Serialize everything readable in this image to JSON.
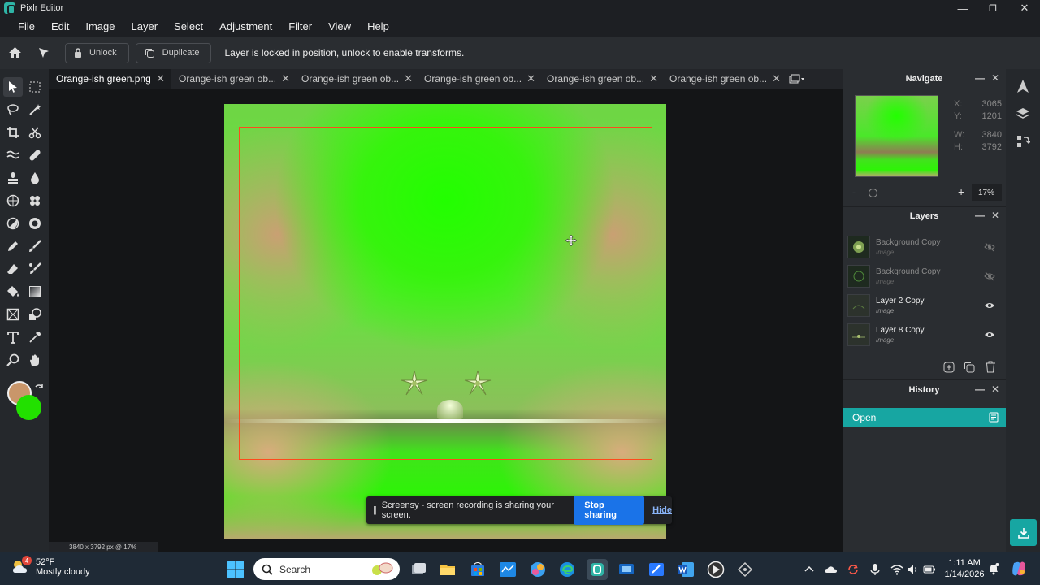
{
  "window": {
    "title": "Pixlr Editor",
    "minimize": "—",
    "maximize": "❐",
    "close": "✕"
  },
  "menu": [
    "File",
    "Edit",
    "Image",
    "Layer",
    "Select",
    "Adjustment",
    "Filter",
    "View",
    "Help"
  ],
  "toolbar": {
    "unlock_label": "Unlock",
    "duplicate_label": "Duplicate",
    "message": "Layer is locked in position, unlock to enable transforms."
  },
  "tabs": [
    {
      "label": "Orange-ish green.png",
      "active": true
    },
    {
      "label": "Orange-ish green ob...",
      "active": false
    },
    {
      "label": "Orange-ish green ob...",
      "active": false
    },
    {
      "label": "Orange-ish green ob...",
      "active": false
    },
    {
      "label": "Orange-ish green ob...",
      "active": false
    },
    {
      "label": "Orange-ish green ob...",
      "active": false
    }
  ],
  "share_bar": {
    "pause": "||",
    "message": "Screensy - screen recording is sharing your screen.",
    "stop_label": "Stop sharing",
    "hide_label": "Hide"
  },
  "status": {
    "size_text": "3840 x 3792 px @ 17%"
  },
  "navigate": {
    "title": "Navigate",
    "x_label": "X:",
    "x_value": "3065",
    "y_label": "Y:",
    "y_value": "1201",
    "w_label": "W:",
    "w_value": "3840",
    "h_label": "H:",
    "h_value": "3792",
    "zoom_minus": "-",
    "zoom_plus": "+",
    "zoom_value": "17%",
    "zoom_level_pct": 17
  },
  "layers": {
    "title": "Layers",
    "items": [
      {
        "name": "Background Copy",
        "type": "Image",
        "visible": false
      },
      {
        "name": "Background Copy",
        "type": "Image",
        "visible": false
      },
      {
        "name": "Layer 2 Copy",
        "type": "Image",
        "visible": true
      },
      {
        "name": "Layer 8 Copy",
        "type": "Image",
        "visible": true
      }
    ]
  },
  "history": {
    "title": "History",
    "items": [
      "Open"
    ]
  },
  "taskbar": {
    "weather_temp": "52°F",
    "weather_desc": "Mostly cloudy",
    "weather_badge": "4",
    "search_placeholder": "Search",
    "time": "1:11 AM",
    "date": "1/14/2026"
  },
  "colors": {
    "accent": "#17a6a2",
    "primary_color": "#c9966a",
    "secondary_color": "#22e000",
    "selection": "#ff4a1c",
    "stop_button": "#1a73e8"
  }
}
